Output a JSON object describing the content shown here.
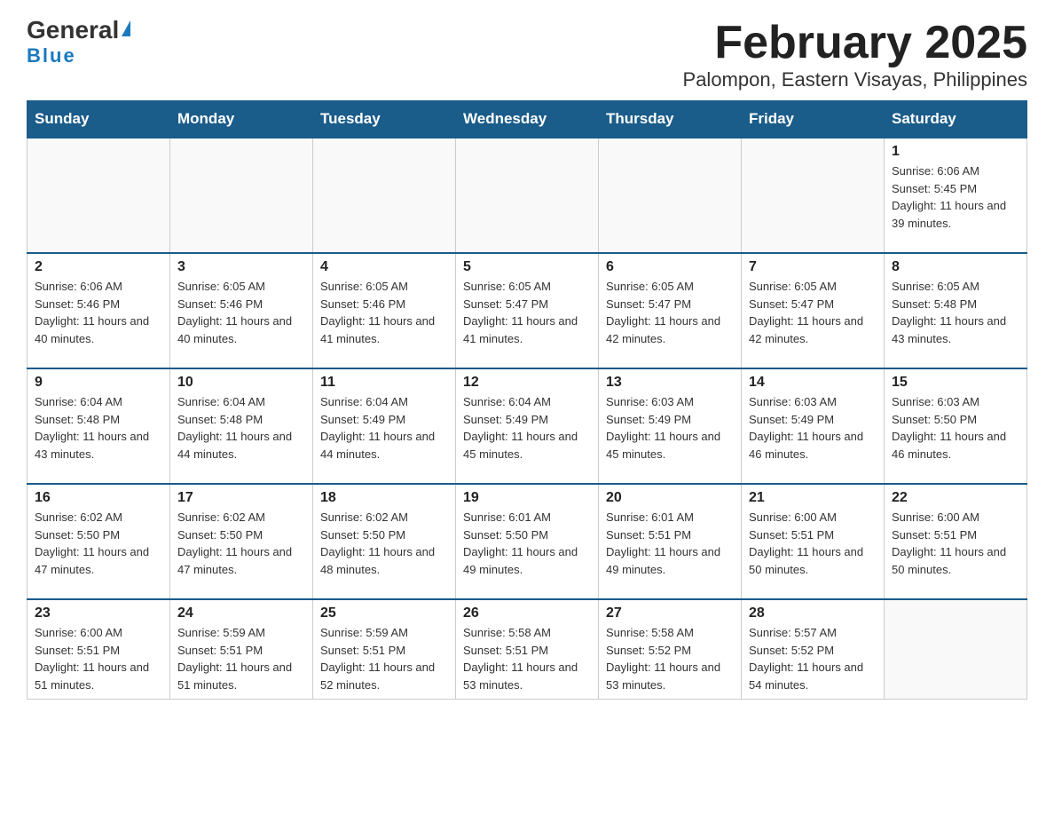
{
  "logo": {
    "text_general": "General",
    "triangle_hint": "blue triangle",
    "text_blue": "Blue"
  },
  "title": "February 2025",
  "subtitle": "Palompon, Eastern Visayas, Philippines",
  "days_of_week": [
    "Sunday",
    "Monday",
    "Tuesday",
    "Wednesday",
    "Thursday",
    "Friday",
    "Saturday"
  ],
  "weeks": [
    [
      {
        "day": "",
        "info": ""
      },
      {
        "day": "",
        "info": ""
      },
      {
        "day": "",
        "info": ""
      },
      {
        "day": "",
        "info": ""
      },
      {
        "day": "",
        "info": ""
      },
      {
        "day": "",
        "info": ""
      },
      {
        "day": "1",
        "info": "Sunrise: 6:06 AM\nSunset: 5:45 PM\nDaylight: 11 hours\nand 39 minutes."
      }
    ],
    [
      {
        "day": "2",
        "info": "Sunrise: 6:06 AM\nSunset: 5:46 PM\nDaylight: 11 hours\nand 40 minutes."
      },
      {
        "day": "3",
        "info": "Sunrise: 6:05 AM\nSunset: 5:46 PM\nDaylight: 11 hours\nand 40 minutes."
      },
      {
        "day": "4",
        "info": "Sunrise: 6:05 AM\nSunset: 5:46 PM\nDaylight: 11 hours\nand 41 minutes."
      },
      {
        "day": "5",
        "info": "Sunrise: 6:05 AM\nSunset: 5:47 PM\nDaylight: 11 hours\nand 41 minutes."
      },
      {
        "day": "6",
        "info": "Sunrise: 6:05 AM\nSunset: 5:47 PM\nDaylight: 11 hours\nand 42 minutes."
      },
      {
        "day": "7",
        "info": "Sunrise: 6:05 AM\nSunset: 5:47 PM\nDaylight: 11 hours\nand 42 minutes."
      },
      {
        "day": "8",
        "info": "Sunrise: 6:05 AM\nSunset: 5:48 PM\nDaylight: 11 hours\nand 43 minutes."
      }
    ],
    [
      {
        "day": "9",
        "info": "Sunrise: 6:04 AM\nSunset: 5:48 PM\nDaylight: 11 hours\nand 43 minutes."
      },
      {
        "day": "10",
        "info": "Sunrise: 6:04 AM\nSunset: 5:48 PM\nDaylight: 11 hours\nand 44 minutes."
      },
      {
        "day": "11",
        "info": "Sunrise: 6:04 AM\nSunset: 5:49 PM\nDaylight: 11 hours\nand 44 minutes."
      },
      {
        "day": "12",
        "info": "Sunrise: 6:04 AM\nSunset: 5:49 PM\nDaylight: 11 hours\nand 45 minutes."
      },
      {
        "day": "13",
        "info": "Sunrise: 6:03 AM\nSunset: 5:49 PM\nDaylight: 11 hours\nand 45 minutes."
      },
      {
        "day": "14",
        "info": "Sunrise: 6:03 AM\nSunset: 5:49 PM\nDaylight: 11 hours\nand 46 minutes."
      },
      {
        "day": "15",
        "info": "Sunrise: 6:03 AM\nSunset: 5:50 PM\nDaylight: 11 hours\nand 46 minutes."
      }
    ],
    [
      {
        "day": "16",
        "info": "Sunrise: 6:02 AM\nSunset: 5:50 PM\nDaylight: 11 hours\nand 47 minutes."
      },
      {
        "day": "17",
        "info": "Sunrise: 6:02 AM\nSunset: 5:50 PM\nDaylight: 11 hours\nand 47 minutes."
      },
      {
        "day": "18",
        "info": "Sunrise: 6:02 AM\nSunset: 5:50 PM\nDaylight: 11 hours\nand 48 minutes."
      },
      {
        "day": "19",
        "info": "Sunrise: 6:01 AM\nSunset: 5:50 PM\nDaylight: 11 hours\nand 49 minutes."
      },
      {
        "day": "20",
        "info": "Sunrise: 6:01 AM\nSunset: 5:51 PM\nDaylight: 11 hours\nand 49 minutes."
      },
      {
        "day": "21",
        "info": "Sunrise: 6:00 AM\nSunset: 5:51 PM\nDaylight: 11 hours\nand 50 minutes."
      },
      {
        "day": "22",
        "info": "Sunrise: 6:00 AM\nSunset: 5:51 PM\nDaylight: 11 hours\nand 50 minutes."
      }
    ],
    [
      {
        "day": "23",
        "info": "Sunrise: 6:00 AM\nSunset: 5:51 PM\nDaylight: 11 hours\nand 51 minutes."
      },
      {
        "day": "24",
        "info": "Sunrise: 5:59 AM\nSunset: 5:51 PM\nDaylight: 11 hours\nand 51 minutes."
      },
      {
        "day": "25",
        "info": "Sunrise: 5:59 AM\nSunset: 5:51 PM\nDaylight: 11 hours\nand 52 minutes."
      },
      {
        "day": "26",
        "info": "Sunrise: 5:58 AM\nSunset: 5:51 PM\nDaylight: 11 hours\nand 53 minutes."
      },
      {
        "day": "27",
        "info": "Sunrise: 5:58 AM\nSunset: 5:52 PM\nDaylight: 11 hours\nand 53 minutes."
      },
      {
        "day": "28",
        "info": "Sunrise: 5:57 AM\nSunset: 5:52 PM\nDaylight: 11 hours\nand 54 minutes."
      },
      {
        "day": "",
        "info": ""
      }
    ]
  ]
}
